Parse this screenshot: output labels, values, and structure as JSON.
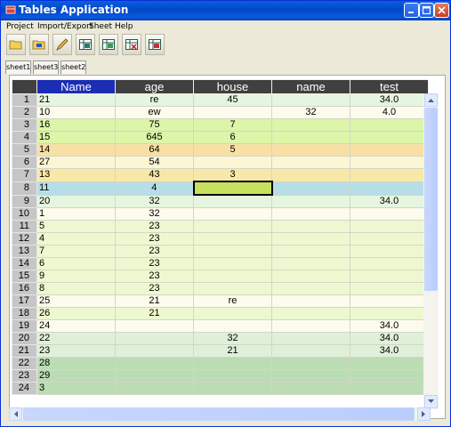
{
  "window": {
    "title": "Tables Application"
  },
  "menu": [
    "Project",
    "Import/Export",
    "Sheet",
    "Help"
  ],
  "toolbar": [
    {
      "name": "open-folder-icon",
      "color": "#e8c34a"
    },
    {
      "name": "save-folder-icon",
      "color": "#e8c34a"
    },
    {
      "name": "edit-pencil-icon",
      "color": "#d6a94a"
    },
    {
      "name": "table-add-icon",
      "color": "#2a7a66"
    },
    {
      "name": "table-save-icon",
      "color": "#2a7a66"
    },
    {
      "name": "table-delete-icon",
      "color": "#c0303a"
    },
    {
      "name": "table-cut-icon",
      "color": "#c0303a"
    }
  ],
  "tabs": [
    "sheet1",
    "sheet3",
    "sheet2"
  ],
  "table": {
    "headers": [
      "",
      "Name",
      "age",
      "house",
      "name",
      "test"
    ],
    "selected_header": 1,
    "current_cell": {
      "row": 8,
      "col": "house"
    },
    "rows": [
      {
        "n": "1",
        "Name": "21",
        "age": "re",
        "house": "45",
        "name": "",
        "test": "34.0",
        "bg": "#e6f5df"
      },
      {
        "n": "2",
        "Name": "10",
        "age": "ew",
        "house": "",
        "name": "32",
        "test": "4.0",
        "bg": "#fdfbec"
      },
      {
        "n": "3",
        "Name": "16",
        "age": "75",
        "house": "7",
        "name": "",
        "test": "",
        "bg": "#dcf5a8"
      },
      {
        "n": "4",
        "Name": "15",
        "age": "645",
        "house": "6",
        "name": "",
        "test": "",
        "bg": "#dcf5a8"
      },
      {
        "n": "5",
        "Name": "14",
        "age": "64",
        "house": "5",
        "name": "",
        "test": "",
        "bg": "#f8e0a4"
      },
      {
        "n": "6",
        "Name": "27",
        "age": "54",
        "house": "",
        "name": "",
        "test": "",
        "bg": "#fcf6d4"
      },
      {
        "n": "7",
        "Name": "13",
        "age": "43",
        "house": "3",
        "name": "",
        "test": "",
        "bg": "#f8e8a8"
      },
      {
        "n": "8",
        "Name": "11",
        "age": "4",
        "house": "",
        "name": "",
        "test": "",
        "bg": "#b7dee6"
      },
      {
        "n": "9",
        "Name": "20",
        "age": "32",
        "house": "",
        "name": "",
        "test": "34.0",
        "bg": "#e6f5df"
      },
      {
        "n": "10",
        "Name": "1",
        "age": "32",
        "house": "",
        "name": "",
        "test": "",
        "bg": "#fdfbec"
      },
      {
        "n": "11",
        "Name": "5",
        "age": "23",
        "house": "",
        "name": "",
        "test": "",
        "bg": "#eef8d0"
      },
      {
        "n": "12",
        "Name": "4",
        "age": "23",
        "house": "",
        "name": "",
        "test": "",
        "bg": "#eef8d0"
      },
      {
        "n": "13",
        "Name": "7",
        "age": "23",
        "house": "",
        "name": "",
        "test": "",
        "bg": "#eef8d0"
      },
      {
        "n": "14",
        "Name": "6",
        "age": "23",
        "house": "",
        "name": "",
        "test": "",
        "bg": "#eef8d0"
      },
      {
        "n": "15",
        "Name": "9",
        "age": "23",
        "house": "",
        "name": "",
        "test": "",
        "bg": "#eef8d0"
      },
      {
        "n": "16",
        "Name": "8",
        "age": "23",
        "house": "",
        "name": "",
        "test": "",
        "bg": "#eef8d0"
      },
      {
        "n": "17",
        "Name": "25",
        "age": "21",
        "house": "re",
        "name": "",
        "test": "",
        "bg": "#fdfbec"
      },
      {
        "n": "18",
        "Name": "26",
        "age": "21",
        "house": "",
        "name": "",
        "test": "",
        "bg": "#eef8d0"
      },
      {
        "n": "19",
        "Name": "24",
        "age": "",
        "house": "",
        "name": "",
        "test": "34.0",
        "bg": "#fdfbec"
      },
      {
        "n": "20",
        "Name": "22",
        "age": "",
        "house": "32",
        "name": "",
        "test": "34.0",
        "bg": "#dff0d8"
      },
      {
        "n": "21",
        "Name": "23",
        "age": "",
        "house": "21",
        "name": "",
        "test": "34.0",
        "bg": "#dff0d8"
      },
      {
        "n": "22",
        "Name": "28",
        "age": "",
        "house": "",
        "name": "",
        "test": "",
        "bg": "#bcdcb4"
      },
      {
        "n": "23",
        "Name": "29",
        "age": "",
        "house": "",
        "name": "",
        "test": "",
        "bg": "#bcdcb4"
      },
      {
        "n": "24",
        "Name": "3",
        "age": "",
        "house": "",
        "name": "",
        "test": "",
        "bg": "#bcdcb4"
      }
    ]
  }
}
